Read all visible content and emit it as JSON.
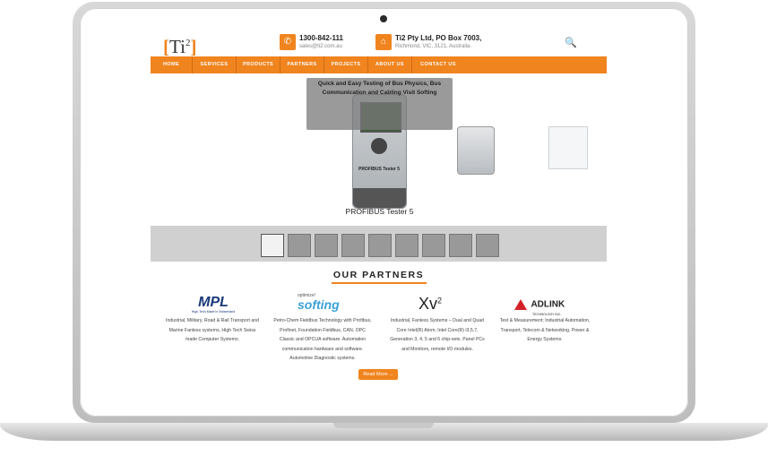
{
  "header": {
    "logo_text": "Ti",
    "logo_sup": "2",
    "phone": "1300-842-111",
    "email": "sales@ti2.com.au",
    "address_line1": "Ti2 Pty Ltd, PO Box 7003,",
    "address_line2": "Richmond, VIC, 3121, Australia."
  },
  "nav": {
    "items": [
      {
        "label": "HOME"
      },
      {
        "label": "SERVICES"
      },
      {
        "label": "PRODUCTS"
      },
      {
        "label": "PARTNERS"
      },
      {
        "label": "PROJECTS"
      },
      {
        "label": "ABOUT US"
      },
      {
        "label": "CONTACT US"
      }
    ]
  },
  "slider": {
    "overlay_text": "Quick and Easy Testing of Bus Physics, Bus Communication and Cabling Visit Softing",
    "device_label": "PROFIBUS Tester 5",
    "caption": "PROFIBUS Tester 5",
    "thumbnail_count": 9
  },
  "partners": {
    "title": "OUR PARTNERS",
    "items": [
      {
        "logo": "MPL",
        "logo_sub": "High-Tech-Made in Switzerland",
        "text": "Industrial, Military, Road & Rail Transport and Marine Fanless systems, High Tech Swiss made Computer Systems."
      },
      {
        "logo": "softing",
        "logo_sub": "optimize!",
        "text": "Petro-Chem Fieldbus Technology with Profibus, Profinet, Foundation Fieldbus, CAN, OPC Classic and OPCUA software. Automation communication hardware and software. Automotive Diagnostic systems."
      },
      {
        "logo": "Xv",
        "logo_sup": "2",
        "text": "Industrial, Fanless Systems – Dual and Quad Core Intel(R) Atom, Intel Core(R) i3,5,7, Generation 3, 4, 5 and 6 chip-sets. Panel PCs and Monitors, remote I/O modules."
      },
      {
        "logo": "ADLINK",
        "logo_sub": "TECHNOLOGY INC.",
        "text": "Test & Measurement; Industrial Automation, Transport, Telecom & Networking, Power & Energy Systems."
      }
    ],
    "read_more": "Read More ..."
  },
  "colors": {
    "accent": "#f0841e",
    "laptop_frame": "#c8c8c8",
    "thumb_strip": "#d0d0d0"
  }
}
